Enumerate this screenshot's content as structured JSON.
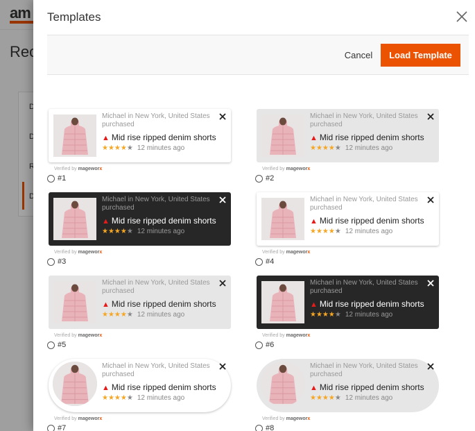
{
  "background": {
    "logo": "am",
    "page_title": "Rec",
    "side_items": [
      "D",
      "D",
      "R",
      "D"
    ]
  },
  "modal": {
    "title": "Templates",
    "cancel_label": "Cancel",
    "load_label": "Load Template"
  },
  "notification": {
    "who": "Michael in New York, United States purchased",
    "product": "Mid rise ripped denim shorts",
    "stars_filled": "★★★★",
    "stars_empty": "★",
    "rating": 4,
    "time": "12 minutes ago",
    "verified_prefix": "Verified by",
    "brand_main": "mageworx"
  },
  "templates": [
    {
      "label": "#1",
      "style": "light"
    },
    {
      "label": "#2",
      "style": "grey"
    },
    {
      "label": "#3",
      "style": "dark"
    },
    {
      "label": "#4",
      "style": "light"
    },
    {
      "label": "#5",
      "style": "grey"
    },
    {
      "label": "#6",
      "style": "dark"
    },
    {
      "label": "#7",
      "style": "light pill round-thumb"
    },
    {
      "label": "#8",
      "style": "grey pill round-thumb"
    }
  ],
  "colors": {
    "accent": "#eb5202",
    "dark_card": "#272727",
    "grey_card": "#e6e6e6",
    "star": "#f5a623",
    "fire": "#e41c1c"
  }
}
